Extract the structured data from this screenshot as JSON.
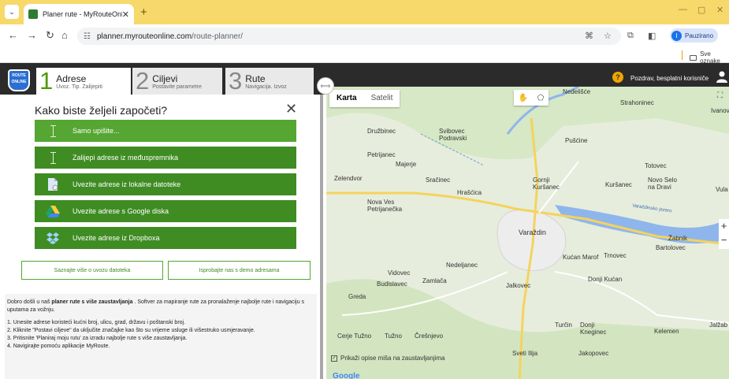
{
  "browser": {
    "tab_menu_icon": "chevron-down",
    "tab_title": "Planer rute - MyRouteOnline",
    "new_tab": "+",
    "url_host": "planner.myrouteonline.com",
    "url_path": "/route-planner/",
    "paused_label": "Pauzirano",
    "paused_avatar": "I",
    "bookmarks_folder": "Sve oznake"
  },
  "app": {
    "logo_text": "ROUTE ONLINE",
    "steps": [
      {
        "num": "1",
        "title": "Adrese",
        "sub": "Uvoz. Tip. Zalijepiti"
      },
      {
        "num": "2",
        "title": "Ciljevi",
        "sub": "Postavite parametre"
      },
      {
        "num": "3",
        "title": "Rute",
        "sub": "Navigacija. Izvoz"
      }
    ],
    "greeting": "Pozdrav, besplatni korisniče",
    "help_icon": "?"
  },
  "panel": {
    "title": "Kako biste željeli započeti?",
    "close": "✕",
    "options": [
      "Samo upišite...",
      "Zalijepi adrese iz međuspremnika",
      "Uvezite adrese iz lokalne datoteke",
      "Uvezite adrese s Google diska",
      "Uvezite adrese iz Dropboxa"
    ],
    "learn_more": "Saznajte više o uvozu datoteka",
    "demo": "Isprobajte nas s demo adresama",
    "info_intro": "Dobro došli u naš ",
    "info_bold": "planer rute s više zaustavljanja",
    "info_rest": " . Softver za mapiranje rute za pronalaženje najbolje rute i navigaciju s uputama za vožnju.",
    "steps": [
      "1. Unesite adrese koristeći kućni broj, ulicu, grad, državu i poštanski broj.",
      "2. Kliknite \"Postavi ciljeve\" da uključite značajke kao što su vrijeme usluge ili višestruko usmjeravanje.",
      "3. Pritisnite 'Planiraj moju rutu' za izradu najbolje rute s više zaustavljanja.",
      "4. Navigirajte pomoću aplikacije MyRoute."
    ]
  },
  "map": {
    "type_map": "Karta",
    "type_sat": "Satelit",
    "hover_option": "Prikaži opise miša na zaustavljanjima",
    "google": "Google",
    "lake_label": "Varaždinsko jezero",
    "places": [
      "Nedelišće",
      "Strahoninec",
      "Ivanov",
      "Družbinec",
      "Svibovec Podravski",
      "Pušćine",
      "Petrijanec",
      "Majerje",
      "Totovec",
      "Zelendvor",
      "Sračinec",
      "Gornji Kuršanec",
      "Kuršanec",
      "Novo Selo na Dravi",
      "Vula",
      "Hrašćica",
      "Nova Ves Petrijanečka",
      "Varaždin",
      "Žabnik",
      "Bartolovec",
      "Kućan Marof",
      "Trnovec",
      "Nedeljanec",
      "Vidovec",
      "Zamlača",
      "Budislavec",
      "Jalkovec",
      "Donji Kućan",
      "Greda",
      "Tužno",
      "Cerje Tužno",
      "Črešnjevo",
      "Turčin",
      "Donji Kneginec",
      "Kelemen",
      "Jalžab",
      "Sveti Ilija",
      "Jakopovec"
    ]
  }
}
